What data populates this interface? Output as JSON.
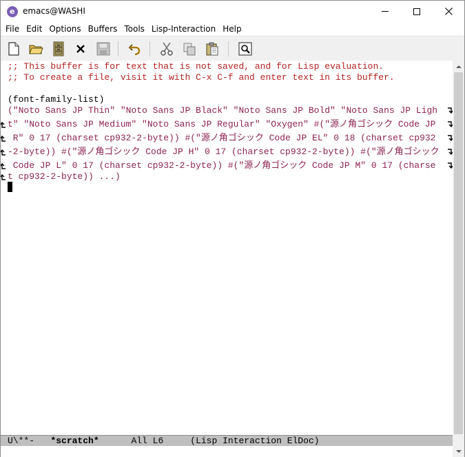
{
  "window": {
    "title": "emacs@WASHI",
    "app_icon_letter": "e",
    "controls": [
      "minimize",
      "maximize",
      "close"
    ]
  },
  "menubar": {
    "items": [
      "File",
      "Edit",
      "Options",
      "Buffers",
      "Tools",
      "Lisp-Interaction",
      "Help"
    ]
  },
  "toolbar": {
    "buttons": [
      {
        "name": "new-file-icon"
      },
      {
        "name": "open-folder-icon"
      },
      {
        "name": "dired-cabinet-icon"
      },
      {
        "name": "close-buffer-icon"
      },
      {
        "name": "save-icon"
      },
      {
        "name": "undo-icon"
      },
      {
        "name": "cut-icon"
      },
      {
        "name": "copy-icon"
      },
      {
        "name": "paste-icon"
      },
      {
        "name": "search-icon"
      }
    ]
  },
  "editor": {
    "comment_line_1": ";; This buffer is for text that is not saved, and for Lisp evaluation.",
    "comment_line_2": ";; To create a file, visit it with C-x C-f and enter text in its buffer.",
    "call_line": "(font-family-list)",
    "result_lines": [
      "(\"Noto Sans JP Thin\" \"Noto Sans JP Black\" \"Noto Sans JP Bold\" \"Noto Sans JP Ligh",
      "t\" \"Noto Sans JP Medium\" \"Noto Sans JP Regular\" \"Oxygen\" #(\"源ノ角ゴシック Code JP",
      " R\" 0 17 (charset cp932-2-byte)) #(\"源ノ角ゴシック Code JP EL\" 0 18 (charset cp932",
      "-2-byte)) #(\"源ノ角ゴシック Code JP H\" 0 17 (charset cp932-2-byte)) #(\"源ノ角ゴシック",
      " Code JP L\" 0 17 (charset cp932-2-byte)) #(\"源ノ角ゴシック Code JP M\" 0 17 (charse",
      "t cp932-2-byte)) ...)"
    ]
  },
  "modeline": {
    "status": "U\\**-",
    "buffer_name": "*scratch*",
    "position": "All L6",
    "modes": "(Lisp Interaction ElDoc)"
  },
  "colors": {
    "comment": "#b22222",
    "string": "#8b2252",
    "modeline_bg": "#bfbfbf",
    "toolbar_bg": "#f0f0f0"
  }
}
